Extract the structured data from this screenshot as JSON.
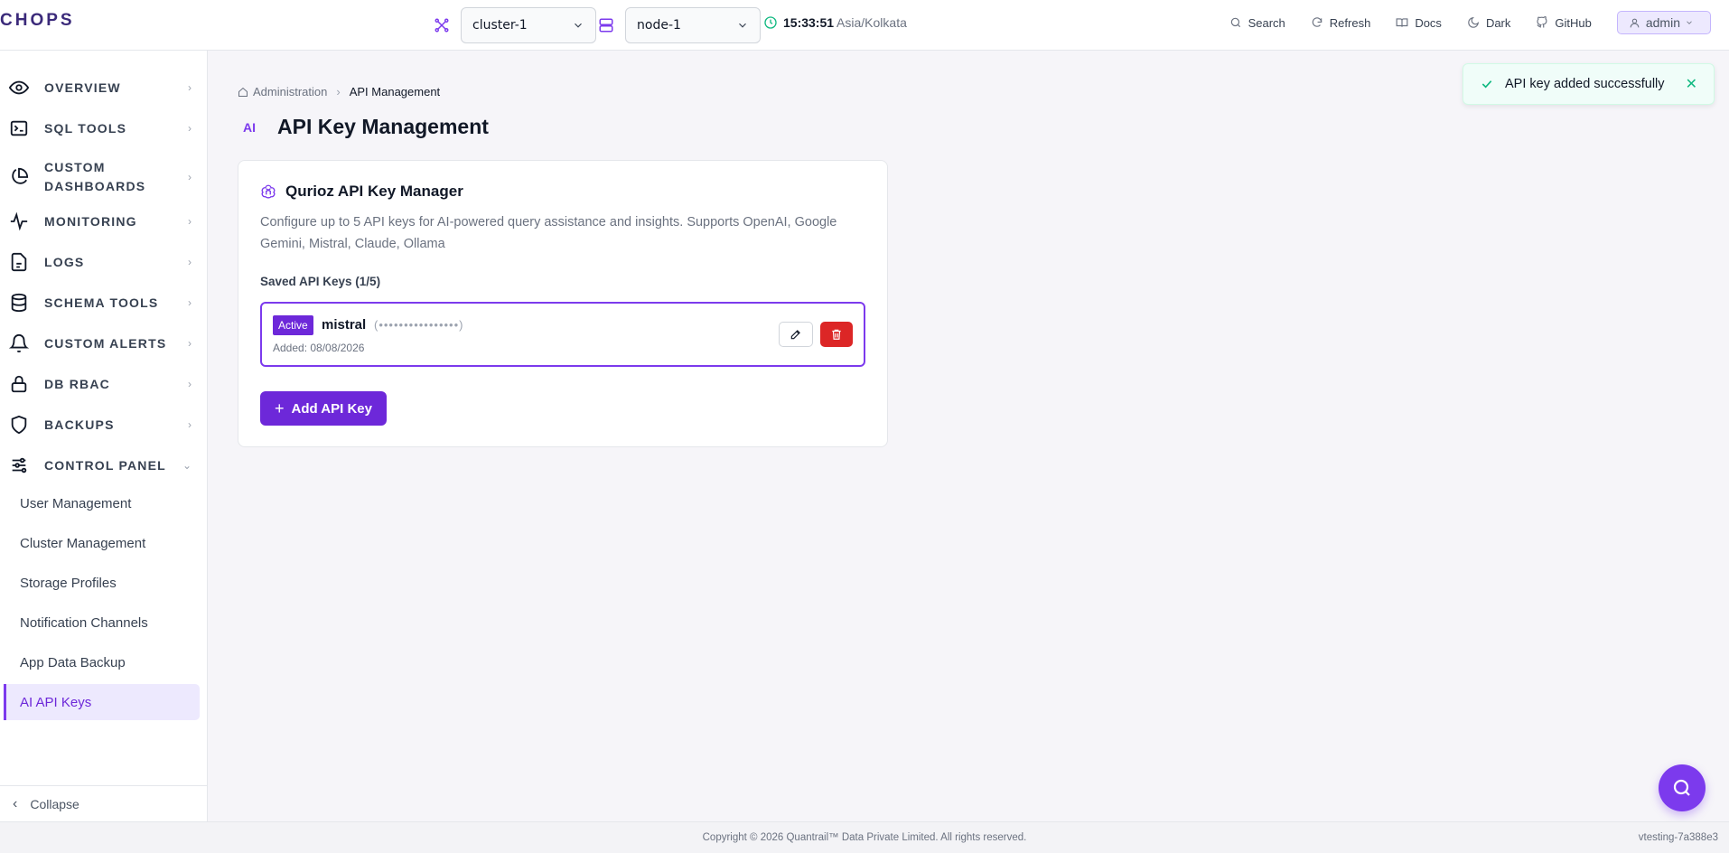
{
  "header": {
    "logo": "CHOPS",
    "cluster_value": "cluster-1",
    "node_value": "node-1",
    "time": "15:33:51",
    "timezone": "Asia/Kolkata",
    "actions": {
      "search": "Search",
      "refresh": "Refresh",
      "docs": "Docs",
      "dark": "Dark",
      "github": "GitHub"
    },
    "user": "admin"
  },
  "sidebar": {
    "items": [
      {
        "label": "OVERVIEW",
        "icon": "eye-icon"
      },
      {
        "label": "SQL TOOLS",
        "icon": "terminal-icon"
      },
      {
        "label": "CUSTOM DASHBOARDS",
        "icon": "pie-chart-icon"
      },
      {
        "label": "MONITORING",
        "icon": "activity-icon"
      },
      {
        "label": "LOGS",
        "icon": "file-text-icon"
      },
      {
        "label": "SCHEMA TOOLS",
        "icon": "database-icon"
      },
      {
        "label": "CUSTOM ALERTS",
        "icon": "bell-icon"
      },
      {
        "label": "DB RBAC",
        "icon": "lock-icon"
      },
      {
        "label": "BACKUPS",
        "icon": "shield-icon"
      },
      {
        "label": "CONTROL PANEL",
        "icon": "sliders-icon"
      }
    ],
    "control_panel_items": [
      "User Management",
      "Cluster Management",
      "Storage Profiles",
      "Notification Channels",
      "App Data Backup",
      "AI API Keys"
    ],
    "collapse": "Collapse"
  },
  "breadcrumb": {
    "root": "Administration",
    "current": "API Management"
  },
  "page": {
    "badge": "AI",
    "title": "API Key Management"
  },
  "card": {
    "title": "Qurioz API Key Manager",
    "description": "Configure up to 5 API keys for AI-powered query assistance and insights. Supports OpenAI, Google Gemini, Mistral, Claude, Ollama",
    "saved_label": "Saved API Keys (1/5)",
    "keys": [
      {
        "status": "Active",
        "provider": "mistral",
        "masked": "(••••••••••••••••)",
        "added": "Added: 08/08/2026"
      }
    ],
    "add_button": "Add API Key"
  },
  "toast": {
    "message": "API key added successfully"
  },
  "footer": {
    "copyright": "Copyright © 2026 Quantrail™ Data Private Limited. All rights reserved.",
    "version": "vtesting-7a388e3"
  },
  "colors": {
    "accent": "#7c3aed",
    "danger": "#dc2626",
    "success": "#10b981"
  }
}
